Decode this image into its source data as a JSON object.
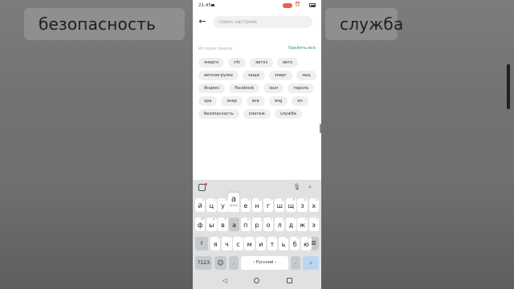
{
  "background": {
    "left_word": "безопасность",
    "right_word": "служба"
  },
  "status_bar": {
    "time": "21:45"
  },
  "search": {
    "placeholder": "Поиск настроек"
  },
  "history": {
    "title": "История поиска",
    "clear_label": "Удалить все",
    "rows": [
      [
        "энерго",
        "nfc",
        "автоз",
        "авто"
      ],
      [
        "автозагрузка",
        "защи",
        "энерг",
        "защ"
      ],
      [
        "Яндекс",
        "Facebook",
        "laun",
        "пароль"
      ],
      [
        "хра",
        "энер",
        "все",
        "eng",
        "en"
      ],
      [
        "безопасность",
        "платеж",
        "служба"
      ]
    ]
  },
  "keyboard": {
    "popup_key": "а",
    "popup_sub": "аkeep",
    "row1": [
      {
        "k": "й",
        "h": "1"
      },
      {
        "k": "ц",
        "h": "2"
      },
      {
        "k": "у",
        "h": "3"
      },
      {
        "k": "к",
        "h": "4"
      },
      {
        "k": "е",
        "h": "5"
      },
      {
        "k": "н",
        "h": "6"
      },
      {
        "k": "г",
        "h": "7"
      },
      {
        "k": "ш",
        "h": "8"
      },
      {
        "k": "щ",
        "h": "9"
      },
      {
        "k": "з",
        "h": "0"
      },
      {
        "k": "х",
        "h": "ъ"
      }
    ],
    "row2": [
      {
        "k": "ф",
        "h": "@"
      },
      {
        "k": "ы",
        "h": "#"
      },
      {
        "k": "в",
        "h": "₽"
      },
      {
        "k": "а",
        "h": "_"
      },
      {
        "k": "п",
        "h": "&"
      },
      {
        "k": "р",
        "h": "-"
      },
      {
        "k": "о",
        "h": "+"
      },
      {
        "k": "л",
        "h": "("
      },
      {
        "k": "д",
        "h": ")"
      },
      {
        "k": "ж",
        "h": "/"
      },
      {
        "k": "э",
        "h": "*"
      }
    ],
    "row3": [
      {
        "k": "я",
        "h": "*"
      },
      {
        "k": "ч",
        "h": "\""
      },
      {
        "k": "с",
        "h": "'"
      },
      {
        "k": "м",
        "h": ":"
      },
      {
        "k": "и",
        "h": ";"
      },
      {
        "k": "т",
        "h": "!"
      },
      {
        "k": "ь",
        "h": "?"
      },
      {
        "k": "б",
        "h": "<"
      },
      {
        "k": "ю",
        "h": ">"
      }
    ],
    "shift_icon": "shift-icon",
    "backspace_icon": "backspace-icon",
    "symbols_label": "?123",
    "emoji_key": "☺",
    "comma_label": ",",
    "space_label": "‹ Русский ›",
    "period_label": ".",
    "go_icon": "search-icon"
  },
  "colors": {
    "accent": "#2c8a6e",
    "go_key": "#bcd6ee",
    "keyboard_bg": "#dfe1e3",
    "record_pill": "#e4624e"
  }
}
